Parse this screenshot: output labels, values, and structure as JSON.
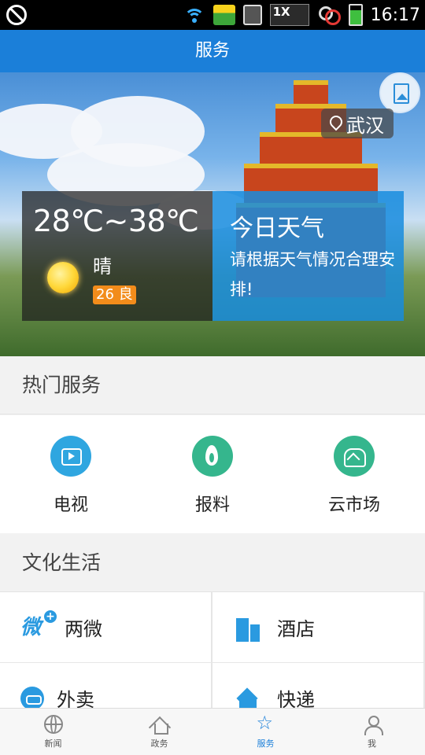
{
  "status_bar": {
    "time": "16:17",
    "speed_badge": "1X",
    "battery_level_percent": 75,
    "icons": [
      "notification-off-icon",
      "wifi-icon",
      "gallery-icon",
      "sd-card-icon",
      "speed-badge-icon",
      "key-blocked-icon",
      "battery-icon"
    ]
  },
  "header": {
    "title": "服务"
  },
  "hero": {
    "location": "武汉",
    "weather": {
      "temp_range": "28℃~38℃",
      "condition": "晴",
      "aqi": "26 良",
      "panel_title": "今日天气",
      "panel_desc": "请根据天气情况合理安排!"
    },
    "colors": {
      "panel_blue": "#188cde",
      "aqi_orange": "#f28c1b"
    }
  },
  "hot_services": {
    "title": "热门服务",
    "items": [
      {
        "label": "电视",
        "icon": "tv-icon",
        "color": "#2fa6e0"
      },
      {
        "label": "报料",
        "icon": "flame-icon",
        "color": "#35b68d"
      },
      {
        "label": "云市场",
        "icon": "cloud-market-icon",
        "color": "#35b68d"
      }
    ]
  },
  "culture_life": {
    "title": "文化生活",
    "items": [
      {
        "label": "两微",
        "icon": "weibo-wechat-icon"
      },
      {
        "label": "酒店",
        "icon": "hotel-icon"
      },
      {
        "label": "外卖",
        "icon": "delivery-scooter-icon"
      },
      {
        "label": "快递",
        "icon": "parcel-box-icon"
      }
    ]
  },
  "bottom_nav": {
    "active": "服务",
    "items": [
      {
        "label": "新闻",
        "icon": "globe-icon"
      },
      {
        "label": "政务",
        "icon": "home-icon"
      },
      {
        "label": "服务",
        "icon": "star-service-icon"
      },
      {
        "label": "我",
        "icon": "user-icon"
      }
    ],
    "accent": "#1b7fd9"
  }
}
